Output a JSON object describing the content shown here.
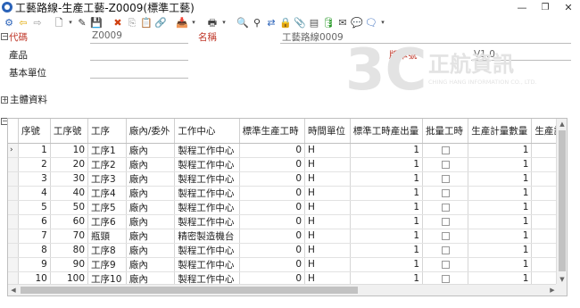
{
  "window": {
    "title": "工藝路線-生產工藝-Z0009(標準工藝)",
    "minimize_glyph": "—",
    "restore_glyph": "❐",
    "close_glyph": "✕"
  },
  "toolbar": {
    "icons": [
      {
        "name": "settings-icon",
        "glyph": "⚙",
        "color": "#2a62b8"
      },
      {
        "name": "back-arrow-icon",
        "glyph": "⇦",
        "color": "#e0a800"
      },
      {
        "name": "forward-arrow-icon",
        "glyph": "⇨",
        "color": "#a0a0a0"
      },
      {
        "name": "new-document-icon",
        "glyph": "🗋",
        "color": "#333333"
      },
      {
        "name": "edit-icon",
        "glyph": "✎",
        "color": "#333333"
      },
      {
        "name": "save-icon",
        "glyph": "💾",
        "color": "#7a7a7a"
      },
      {
        "name": "delete-icon",
        "glyph": "✖",
        "color": "#d04010"
      },
      {
        "name": "copy-icon",
        "glyph": "⎘",
        "color": "#999999"
      },
      {
        "name": "paste-icon",
        "glyph": "📋",
        "color": "#999999"
      },
      {
        "name": "link-icon",
        "glyph": "🔗",
        "color": "#999999"
      },
      {
        "name": "import-icon",
        "glyph": "📥",
        "color": "#555555"
      },
      {
        "name": "print-icon",
        "glyph": "🖶",
        "color": "#444444"
      },
      {
        "name": "query-icon",
        "glyph": "🔍",
        "color": "#333333"
      },
      {
        "name": "filter-icon",
        "glyph": "⚲",
        "color": "#333333"
      },
      {
        "name": "transfer-icon",
        "glyph": "⇄",
        "color": "#2a62b8"
      },
      {
        "name": "lock-icon",
        "glyph": "🔒",
        "color": "#d0a000"
      },
      {
        "name": "attachment-icon",
        "glyph": "📎",
        "color": "#2a62b8"
      },
      {
        "name": "report-icon",
        "glyph": "▤",
        "color": "#555555"
      },
      {
        "name": "database-icon",
        "glyph": "🛢",
        "color": "#2a9a2a"
      },
      {
        "name": "mail-icon",
        "glyph": "✉",
        "color": "#444444"
      },
      {
        "name": "chat-icon",
        "glyph": "💬",
        "color": "#444444"
      },
      {
        "name": "message-icon",
        "glyph": "🗨",
        "color": "#2a62b8"
      }
    ]
  },
  "header": {
    "code_label": "代碼",
    "code_value": "Z0009",
    "name_label": "名稱",
    "name_value": "工藝路線0009",
    "product_label": "產品",
    "version_label": "版本號",
    "version_value": "V1.0",
    "base_unit_label": "基本單位",
    "expander_collapse": "−"
  },
  "watermark": {
    "logo_digits": "3C",
    "company": "正航資訊",
    "subtitle": "CHING HANG INFORMATION CO., LTD."
  },
  "section": {
    "expander_expand": "+",
    "main_data_label": "主體資料"
  },
  "grid": {
    "collapse_glyph": "−",
    "columns": [
      "序號",
      "工序號",
      "工序",
      "廠內/委外",
      "工作中心",
      "標準生產工時",
      "時間單位",
      "標準工時產出量",
      "批量工時",
      "生產計量數量",
      "生產計"
    ],
    "current_row_marker": "›",
    "rows": [
      {
        "seq": "1",
        "op_no": "10",
        "op": "工序1",
        "src": "廠內",
        "center": "製程工作中心",
        "std_time": "0",
        "unit": "H",
        "output": "1",
        "batch": "",
        "qty": "1"
      },
      {
        "seq": "2",
        "op_no": "20",
        "op": "工序2",
        "src": "廠內",
        "center": "製程工作中心",
        "std_time": "0",
        "unit": "H",
        "output": "1",
        "batch": "",
        "qty": "1"
      },
      {
        "seq": "3",
        "op_no": "30",
        "op": "工序3",
        "src": "廠內",
        "center": "製程工作中心",
        "std_time": "0",
        "unit": "H",
        "output": "1",
        "batch": "",
        "qty": "1"
      },
      {
        "seq": "4",
        "op_no": "40",
        "op": "工序4",
        "src": "廠內",
        "center": "製程工作中心",
        "std_time": "0",
        "unit": "H",
        "output": "1",
        "batch": "",
        "qty": "1"
      },
      {
        "seq": "5",
        "op_no": "50",
        "op": "工序5",
        "src": "廠內",
        "center": "製程工作中心",
        "std_time": "0",
        "unit": "H",
        "output": "1",
        "batch": "",
        "qty": "1"
      },
      {
        "seq": "6",
        "op_no": "60",
        "op": "工序6",
        "src": "廠內",
        "center": "製程工作中心",
        "std_time": "0",
        "unit": "H",
        "output": "1",
        "batch": "",
        "qty": "1"
      },
      {
        "seq": "7",
        "op_no": "70",
        "op": "瓶頸",
        "src": "廠內",
        "center": "精密製造機台",
        "std_time": "0",
        "unit": "H",
        "output": "1",
        "batch": "",
        "qty": "1"
      },
      {
        "seq": "8",
        "op_no": "80",
        "op": "工序8",
        "src": "廠內",
        "center": "製程工作中心",
        "std_time": "0",
        "unit": "H",
        "output": "1",
        "batch": "",
        "qty": "1"
      },
      {
        "seq": "9",
        "op_no": "90",
        "op": "工序9",
        "src": "廠內",
        "center": "製程工作中心",
        "std_time": "0",
        "unit": "H",
        "output": "1",
        "batch": "",
        "qty": "1"
      },
      {
        "seq": "10",
        "op_no": "100",
        "op": "工序10",
        "src": "廠內",
        "center": "製程工作中心",
        "std_time": "0",
        "unit": "H",
        "output": "1",
        "batch": "",
        "qty": "1"
      }
    ]
  },
  "scroll": {
    "left": "◀",
    "right": "▶",
    "up": "▲",
    "down": "▼"
  },
  "colors": {
    "label_red": "#c0392b",
    "watermark_gray": "#e3e3e3"
  }
}
